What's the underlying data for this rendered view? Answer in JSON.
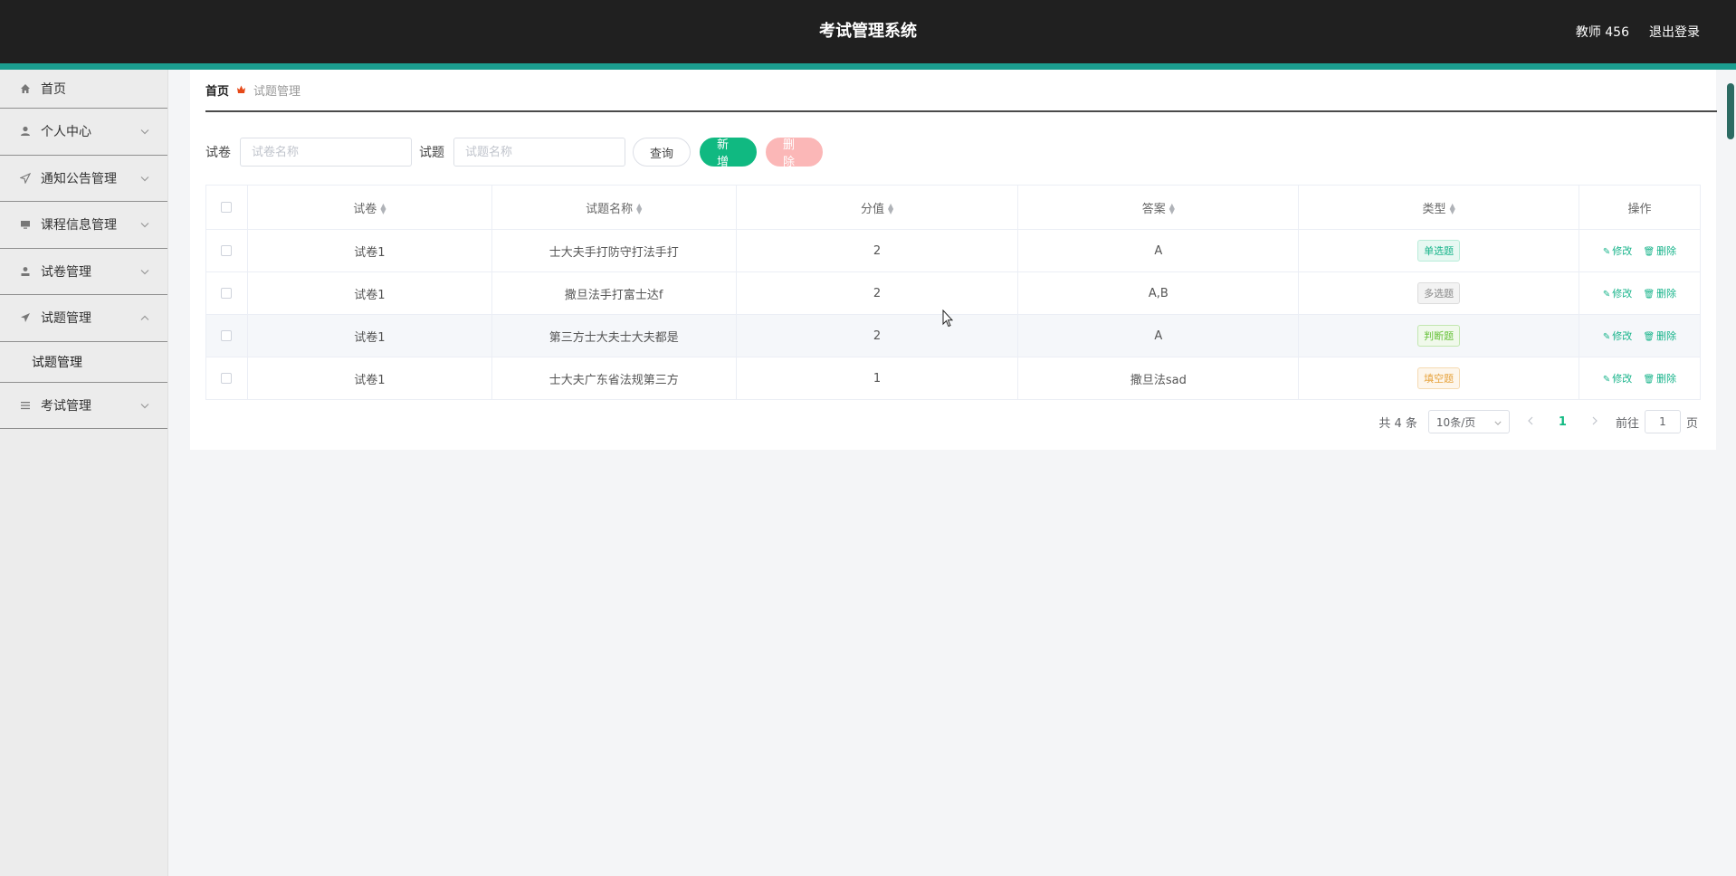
{
  "header": {
    "title": "考试管理系统",
    "user": "教师 456",
    "logout": "退出登录"
  },
  "sidebar": {
    "items": [
      {
        "label": "首页",
        "icon": "home-icon",
        "has_chevron": false
      },
      {
        "label": "个人中心",
        "icon": "user-icon",
        "has_chevron": true
      },
      {
        "label": "通知公告管理",
        "icon": "send-icon",
        "has_chevron": true
      },
      {
        "label": "课程信息管理",
        "icon": "monitor-icon",
        "has_chevron": true
      },
      {
        "label": "试卷管理",
        "icon": "user-icon",
        "has_chevron": true
      },
      {
        "label": "试题管理",
        "icon": "paper-plane-icon",
        "has_chevron": true,
        "expanded": true
      },
      {
        "label": "考试管理",
        "icon": "list-icon",
        "has_chevron": true
      }
    ],
    "submenu": {
      "label": "试题管理"
    }
  },
  "breadcrumb": {
    "home": "首页",
    "current": "试题管理"
  },
  "search": {
    "paper_label": "试卷",
    "paper_placeholder": "试卷名称",
    "question_label": "试题",
    "question_placeholder": "试题名称",
    "query_btn": "查询",
    "add_btn": "新增",
    "delete_btn": "删除"
  },
  "table": {
    "headers": [
      "试卷",
      "试题名称",
      "分值",
      "答案",
      "类型",
      "操作"
    ],
    "rows": [
      {
        "paper": "试卷1",
        "name": "士大夫手打防守打法手打",
        "score": "2",
        "answer": "A",
        "type": "单选题",
        "type_class": "tag-single"
      },
      {
        "paper": "试卷1",
        "name": "撒旦法手打富士达f",
        "score": "2",
        "answer": "A,B",
        "type": "多选题",
        "type_class": "tag-multi"
      },
      {
        "paper": "试卷1",
        "name": "第三方士大夫士大夫都是",
        "score": "2",
        "answer": "A",
        "type": "判断题",
        "type_class": "tag-judge"
      },
      {
        "paper": "试卷1",
        "name": "士大夫广东省法规第三方",
        "score": "1",
        "answer": "撒旦法sad",
        "type": "填空题",
        "type_class": "tag-fill"
      }
    ],
    "edit_label": "修改",
    "delete_label": "删除"
  },
  "pagination": {
    "total": "共 4 条",
    "page_size": "10条/页",
    "current_page": "1",
    "goto_prefix": "前往",
    "goto_value": "1",
    "goto_suffix": "页"
  },
  "colors": {
    "accent": "#10b981",
    "topbar": "#202020",
    "topbar_accent": "#1b9d8f"
  }
}
